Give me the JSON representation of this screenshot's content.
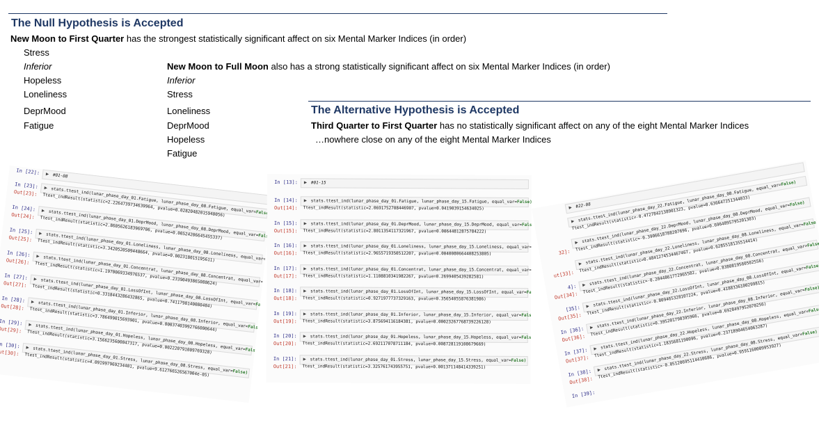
{
  "null": {
    "title": "The Null Hypothesis is Accepted",
    "intro_bold": "New Moon to First Quarter",
    "intro_rest": " has the strongest statistically significant affect on six Mental Marker Indices (in order)",
    "list1": [
      "Stress",
      "Inferior",
      "Hopeless",
      "Loneliness",
      "DeprMood",
      "Fatigue"
    ],
    "full_bold": "New Moon to Full Moon",
    "full_rest": " also has a strong statistically significant affect on six Mental Marker Indices (in order)",
    "list2": [
      "Inferior",
      "Stress",
      "Loneliness",
      "DeprMood",
      "Hopeless",
      "Fatigue"
    ]
  },
  "alt": {
    "title": "The Alternative Hypothesis is Accepted",
    "intro_bold": "Third Quarter to First Quarter",
    "intro_rest": " has no statistically significant affect on any of the eight Mental Marker Indices",
    "note": "…nowhere close on any of the eight Mental Marker Indices"
  },
  "panel_left": {
    "header_prompt": "In [22]:",
    "header_comment": "#01-08",
    "cells": [
      {
        "in": "In [23]:",
        "out": "Out[23]:",
        "code": "stats.ttest_ind(lunar_phase_day_01.Fatigue, lunar_phase_day_08.Fatigue, equal_var=",
        "kw": "False)",
        "result": "Ttest_indResult(statistic=2.2264739734639964, pvalue=0.02820482015940056)"
      },
      {
        "in": "In [24]:",
        "out": "Out[24]:",
        "code": "stats.ttest_ind(lunar_phase_day_01.DeprMood, lunar_phase_day_08.DeprMood, equal_var=",
        "kw": "False)",
        "result": "Ttest_indResult(statistic=2.8605626183969706, pvalue=0.00524206645455337)"
      },
      {
        "in": "In [25]:",
        "out": "Out[25]:",
        "code": "stats.ttest_ind(lunar_phase_day_01.Loneliness, lunar_phase_day_08.Loneliness, equal_var=",
        "kw": "False)",
        "result": "Ttest_indResult(statistic=3.3420520509448664, pvalue=0.002318015195611)"
      },
      {
        "in": "In [26]:",
        "out": "Out[26]:",
        "code": "stats.ttest_ind(lunar_phase_day_01.Concentrat, lunar_phase_day_08.Concentrat, equal_var=",
        "kw": "False)",
        "result": "Ttest_indResult(statistic=1.1970069334976537, pvalue=0.23390493865088624)"
      },
      {
        "in": "In [27]:",
        "out": "Out[27]:",
        "code": "stats.ttest_ind(lunar_phase_day_01.LossOfInt, lunar_phase_day_08.LossOfInt, equal_var=",
        "kw": "False)",
        "result": "Ttest_indResult(statistic=0.3318443286432865, pvalue=0.7411798140080484)"
      },
      {
        "in": "In [28]:",
        "out": "Out[28]:",
        "code": "stats.ttest_ind(lunar_phase_day_01.Inferior, lunar_phase_day_08.Inferior, equal_var=",
        "kw": "False)",
        "result": "Ttest_indResult(statistic=3.786499015693901, pvalue=0.00037403992766000644)"
      },
      {
        "in": "In [29]:",
        "out": "Out[29]:",
        "code": "stats.ttest_ind(lunar_phase_day_01.Hopeless, lunar_phase_day_08.Hopeless, equal_var=",
        "kw": "False)",
        "result": "Ttest_indResult(statistic=3.1566235600047317, pvalue=0.002220791009769328)"
      },
      {
        "in": "In [30]:",
        "out": "Out[30]:",
        "code": "stats.ttest_ind(lunar_phase_day_01.Stress, lunar_phase_day_08.Stress, equal_var=",
        "kw": "False)",
        "result": "Ttest_indResult(statistic=4.091997969234401, pvalue=9.612766526567004e-05)"
      }
    ]
  },
  "panel_mid": {
    "header_prompt": "In [13]:",
    "header_comment": "#01-15",
    "cells": [
      {
        "in": "In [14]:",
        "out": "Out[14]:",
        "code": "stats.ttest_ind(lunar_phase_day_01.Fatigue, lunar_phase_day_15.Fatigue, equal_var=",
        "kw": "False)",
        "result": "Ttest_indResult(statistic=2.0691752708446907, pvalue=0.0419039154634025)"
      },
      {
        "in": "In [15]:",
        "out": "Out[15]:",
        "code": "stats.ttest_ind(lunar_phase_day_01.DeprMood, lunar_phase_day_15.DeprMood, equal_var=",
        "kw": "False)",
        "result": "Ttest_indResult(statistic=2.8011354117321967, pvalue=0.00644812875784222)"
      },
      {
        "in": "In [16]:",
        "out": "Out[16]:",
        "code": "stats.ttest_ind(lunar_phase_day_01.Loneliness, lunar_phase_day_15.Loneliness, equal_var=",
        "kw": "False)",
        "result": "Ttest_indResult(statistic=2.9655719350512207, pvalue=0.0040080664408253805)"
      },
      {
        "in": "In [17]:",
        "out": "Out[17]:",
        "code": "stats.ttest_ind(lunar_phase_day_01.Concentrat, lunar_phase_day_15.Concentrat, equal_var=",
        "kw": "False)",
        "result": "Ttest_indResult(statistic=1.1108810341982267, pvalue=0.2699405439282581)"
      },
      {
        "in": "In [18]:",
        "out": "Out[18]:",
        "code": "stats.ttest_ind(lunar_phase_day_01.LossOfInt, lunar_phase_day_15.LossOfInt, equal_var=",
        "kw": "False)",
        "result": "Ttest_indResult(statistic=0.9271977737329163, pvalue=0.35654055876381986)"
      },
      {
        "in": "In [19]:",
        "out": "Out[19]:",
        "code": "stats.ttest_ind(lunar_phase_day_01.Inferior, lunar_phase_day_15.Inferior, equal_var=",
        "kw": "False)",
        "result": "Ttest_indResult(statistic=3.875694116184381, pvalue=0.00023267768739226128)"
      },
      {
        "in": "In [20]:",
        "out": "Out[20]:",
        "code": "stats.ttest_ind(lunar_phase_day_01.Hopeless, lunar_phase_day_15.Hopeless, equal_var=",
        "kw": "False)",
        "result": "Ttest_indResult(statistic=2.692117078711184, pvalue=0.008728119108679669)"
      },
      {
        "in": "In [21]:",
        "out": "Out[21]:",
        "code": "stats.ttest_ind(lunar_phase_day_01.Stress, lunar_phase_day_15.Stress, equal_var=",
        "kw": "False)",
        "result": "Ttest_indResult(statistic=3.325761743955751, pvalue=0.001371148414339251)"
      }
    ]
  },
  "panel_right": {
    "header_prompt": "",
    "header_comment": "#22-08",
    "cells": [
      {
        "in": "",
        "out": "",
        "code": "stats.ttest_ind(lunar_phase_day_22.Fatigue, lunar_phase_day_08.Fatigue, equal_var=",
        "kw": "False)",
        "result": "Ttest_indResult(statistic=-0.4727842138901323, pvalue=0.636647251344033)"
      },
      {
        "in": "",
        "out": "32]:",
        "code": "stats.ttest_ind(lunar_phase_day_22.DeprMood, lunar_phase_day_08.DeprMood, equal_var=",
        "kw": "False)",
        "result": "Ttest_indResult(statistic=-0.3906618788207696, pvalue=0.6964895795201303)"
      },
      {
        "in": "",
        "out": "ut[33]:",
        "code": "stats.ttest_ind(lunar_phase_day_22.Loneliness, lunar_phase_day_08.Loneliness, equal_var=",
        "kw": "False)",
        "result": "Ttest_indResult(statistic=0.4841274534467467, pvalue=0.6285518135514414)"
      },
      {
        "in": "4]:",
        "out": "Out[34]:",
        "code": "stats.ttest_ind(lunar_phase_day_22.Concentrat, lunar_phase_day_08.Concentrat, equal_var=",
        "kw": "False)",
        "result": "Ttest_indResult(statistic=-0.2044861772965582, pvalue=0.8380819560502556)"
      },
      {
        "in": "[35]:",
        "out": "Out[35]:",
        "code": "stats.ttest_ind(lunar_phase_day_22.LossOfInt, lunar_phase_day_08.LossOfInt, equal_var=",
        "kw": "False)",
        "result": "Ttest_indResult(statistic=-0.809465328107224, pvalue=0.4188336100299815)"
      },
      {
        "in": "In [36]:",
        "out": "Out[36]:",
        "code": "stats.ttest_ind(lunar_phase_day_22.Inferior, lunar_phase_day_08.Inferior, equal_var=",
        "kw": "False)",
        "result": "Ttest_indResult(statistic=0.395201790395966, pvalue=0.6928497952070256)"
      },
      {
        "in": "In [37]:",
        "out": "Out[37]:",
        "code": "stats.ttest_ind(lunar_phase_day_22.Hopeless, lunar_phase_day_08.Hopeless, equal_var=",
        "kw": "False)",
        "result": "Ttest_indResult(statistic=1.1835681190096, pvalue=0.23718904654063287)"
      },
      {
        "in": "In [38]:",
        "out": "Out[38]:",
        "code": "stats.ttest_ind(lunar_phase_day_22.Stress, lunar_phase_day_08.Stress, equal_var=",
        "kw": "False)",
        "result": "Ttest_indResult(statistic=-0.05120695114410686, pvalue=0.9591160009953927)"
      }
    ],
    "footer_prompt": "In [39]:"
  }
}
